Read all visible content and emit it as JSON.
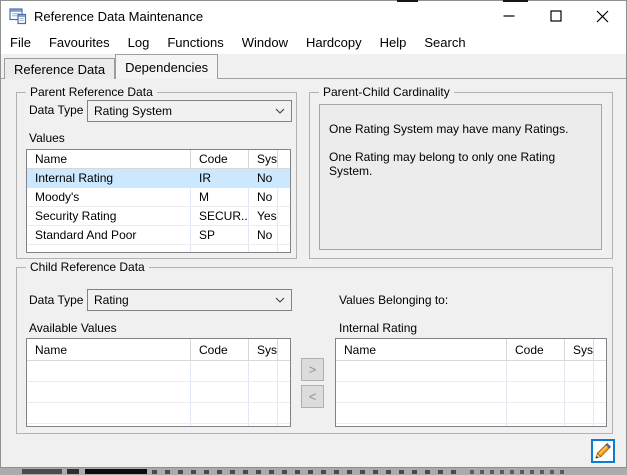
{
  "window": {
    "title": "Reference Data Maintenance"
  },
  "menu": {
    "items": [
      "File",
      "Favourites",
      "Log",
      "Functions",
      "Window",
      "Hardcopy",
      "Help",
      "Search"
    ]
  },
  "tabs": [
    {
      "label": "Reference Data",
      "active": false
    },
    {
      "label": "Dependencies",
      "active": true
    }
  ],
  "parent_section": {
    "title": "Parent Reference Data",
    "data_type_label": "Data Type",
    "data_type_value": "Rating System",
    "values_label": "Values",
    "table": {
      "headers": [
        "Name",
        "Code",
        "Sys..."
      ],
      "rows": [
        {
          "name": "Internal Rating",
          "code": "IR",
          "sys": "No",
          "selected": true
        },
        {
          "name": "Moody's",
          "code": "M",
          "sys": "No",
          "selected": false
        },
        {
          "name": "Security Rating",
          "code": "SECUR...",
          "sys": "Yes",
          "selected": false
        },
        {
          "name": "Standard And Poor",
          "code": "SP",
          "sys": "No",
          "selected": false
        }
      ]
    }
  },
  "cardinality_section": {
    "title": "Parent-Child Cardinality",
    "lines": [
      "One Rating System may have many Ratings.",
      "One Rating may belong to only one Rating System."
    ]
  },
  "child_section": {
    "title": "Child Reference Data",
    "data_type_label": "Data Type",
    "data_type_value": "Rating",
    "available_values_label": "Available Values",
    "values_belonging_label": "Values Belonging to:",
    "belonging_target": "Internal Rating",
    "move_right_label": ">",
    "move_left_label": "<",
    "available_table": {
      "headers": [
        "Name",
        "Code",
        "Sys..."
      ],
      "rows": []
    },
    "belonging_table": {
      "headers": [
        "Name",
        "Code",
        "Sys..."
      ],
      "rows": []
    }
  },
  "icons": {
    "app_icon": "form-icon",
    "edit_icon": "pencil-icon",
    "combo_icon": "chevron-down-icon"
  },
  "colors": {
    "selection": "#cce8ff",
    "edit_button_border": "#0f7ad1",
    "pencil_body": "#f6a01d",
    "window_bg": "#f0f0f0",
    "titlebar_bg": "#ffffff"
  }
}
